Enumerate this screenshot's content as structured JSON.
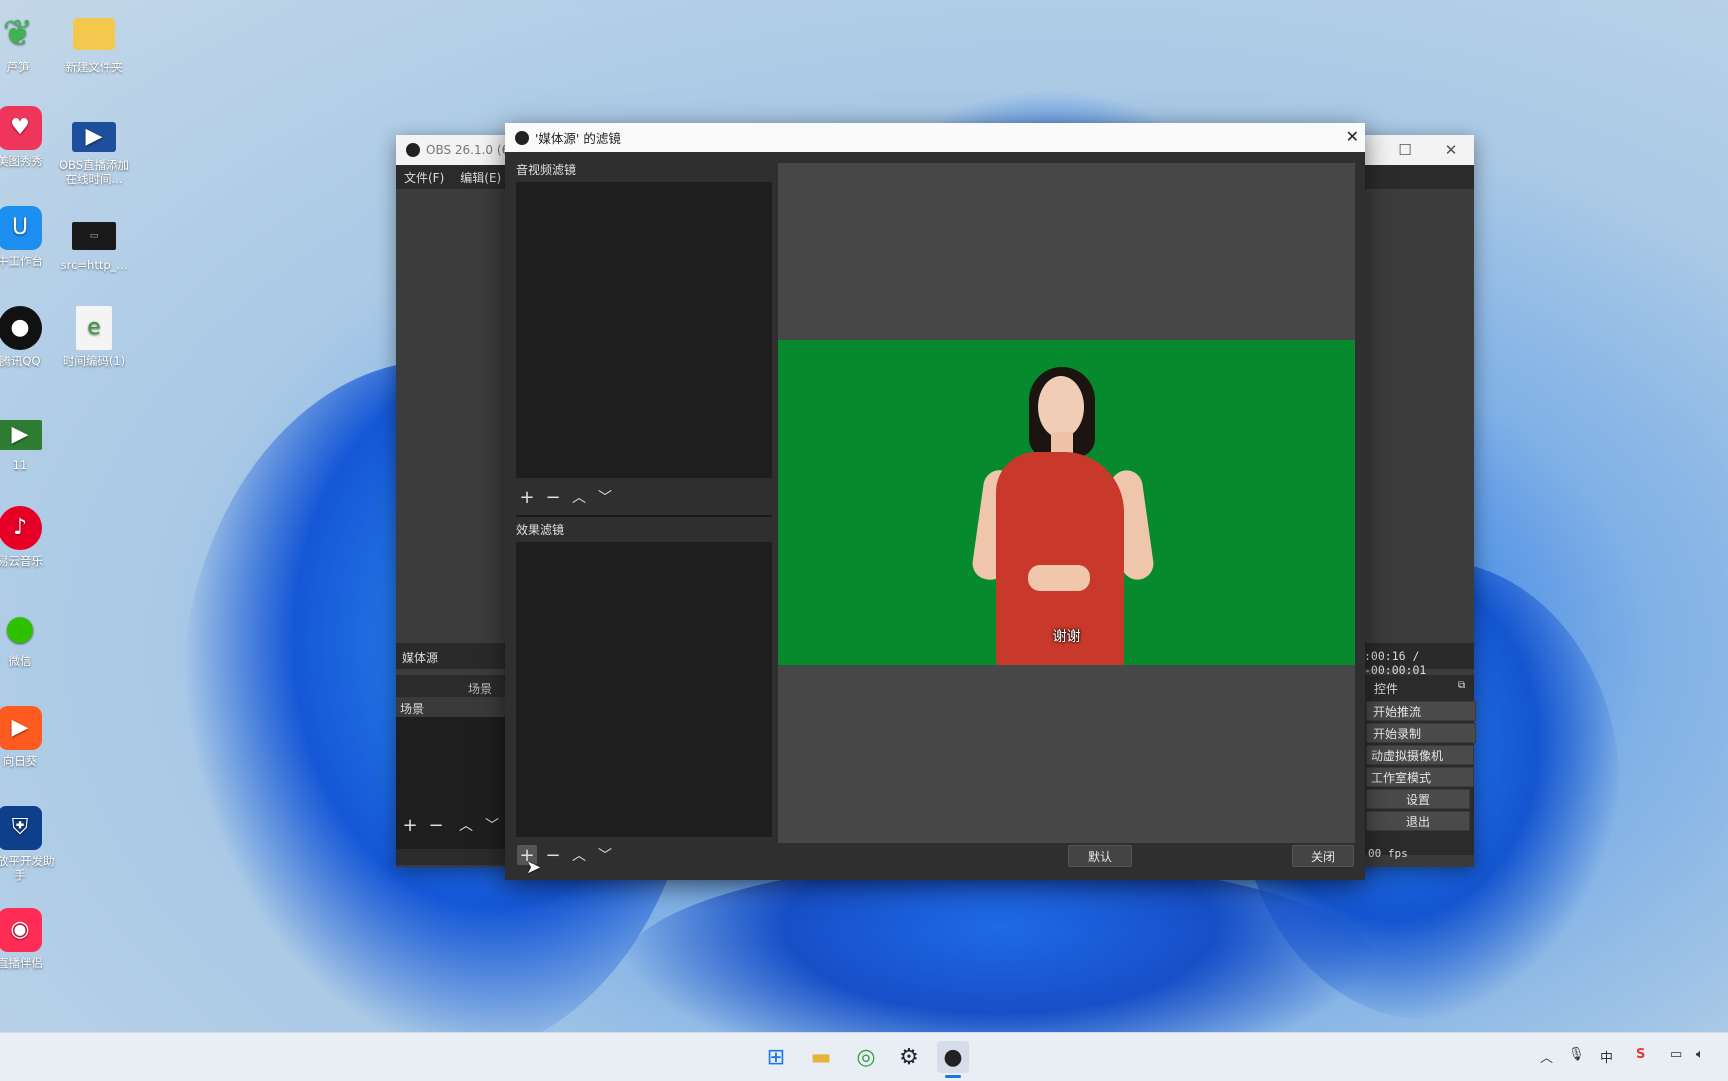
{
  "desktop": {
    "icons": [
      {
        "label": "芦笋"
      },
      {
        "label": "新建文件夹"
      },
      {
        "label": "美图秀秀"
      },
      {
        "label": "OBS直播添加在线时间..."
      },
      {
        "label": "牛工作台"
      },
      {
        "label": "src=http_..."
      },
      {
        "label": "腾讯QQ"
      },
      {
        "label": "时间编码(1)"
      },
      {
        "label": "11"
      },
      {
        "label": "易云音乐"
      },
      {
        "label": "微信"
      },
      {
        "label": "向日葵"
      },
      {
        "label": "开放平开发助手"
      },
      {
        "label": "直播伴侣"
      }
    ]
  },
  "obs_main": {
    "title": "OBS 26.1.0 (6",
    "menu": [
      "文件(F)",
      "编辑(E)"
    ],
    "source_title": "媒体源",
    "scenes_header": "场景",
    "scene_item": "场景",
    "timecode": ":00:16 / -00:00:01",
    "controls_title": "控件",
    "controls": [
      "开始推流",
      "开始录制",
      "动虚拟摄像机",
      "工作室模式",
      "设置",
      "退出"
    ],
    "fps": "00 fps"
  },
  "dialog": {
    "title": "'媒体源' 的滤镜",
    "audio_video_filters_label": "音视频滤镜",
    "effect_filters_label": "效果滤镜",
    "preview_subtitle": "谢谢",
    "default_button": "默认",
    "close_button": "关闭"
  },
  "icons": {
    "add": "plus-icon",
    "remove": "minus-icon",
    "up": "chevron-up-icon",
    "down": "chevron-down-icon",
    "close": "close-icon"
  },
  "colors": {
    "chroma_green": "#078a2d",
    "obs_dark": "#2f2f2f",
    "dress_red": "#c8392b"
  }
}
